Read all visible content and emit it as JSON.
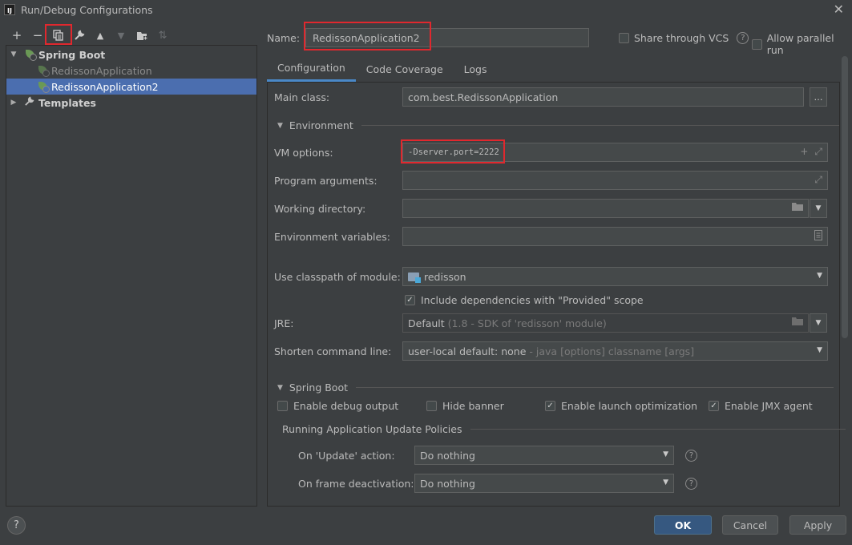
{
  "window": {
    "title": "Run/Debug Configurations",
    "app_icon_text": "IJ"
  },
  "toolbar": {
    "buttons": [
      {
        "name": "add",
        "glyph": "+"
      },
      {
        "name": "remove",
        "glyph": "−"
      },
      {
        "name": "copy",
        "glyph": "⧉"
      },
      {
        "name": "edit-defaults",
        "glyph": "🔧"
      },
      {
        "name": "move-up",
        "glyph": "▲"
      },
      {
        "name": "move-down",
        "glyph": "▼"
      },
      {
        "name": "new-folder",
        "glyph": "📁"
      },
      {
        "name": "sort",
        "glyph": "⇅"
      }
    ]
  },
  "tree": {
    "spring_boot": "Spring Boot",
    "items": [
      "RedissonApplication",
      "RedissonApplication2"
    ],
    "templates": "Templates"
  },
  "header": {
    "name_label": "Name:",
    "name_value": "RedissonApplication2",
    "share_label": "Share through VCS",
    "parallel_label": "Allow parallel run"
  },
  "tabs": [
    "Configuration",
    "Code Coverage",
    "Logs"
  ],
  "config": {
    "main_class_label": "Main class:",
    "main_class_value": "com.best.RedissonApplication",
    "environment_header": "Environment",
    "vm_options_label": "VM options:",
    "vm_options_value": "-Dserver.port=2222",
    "program_args_label": "Program arguments:",
    "working_dir_label": "Working directory:",
    "env_vars_label": "Environment variables:",
    "classpath_label": "Use classpath of module:",
    "classpath_value": "redisson",
    "include_deps_label": "Include dependencies with \"Provided\" scope",
    "jre_label": "JRE:",
    "jre_value": "Default",
    "jre_hint": "(1.8 - SDK of 'redisson' module)",
    "shorten_label": "Shorten command line:",
    "shorten_value": "user-local default: none",
    "shorten_hint": "- java [options] classname [args]",
    "spring_boot_header": "Spring Boot",
    "enable_debug_label": "Enable debug output",
    "hide_banner_label": "Hide banner",
    "launch_opt_label": "Enable launch optimization",
    "jmx_label": "Enable JMX agent",
    "policies_header": "Running Application Update Policies",
    "on_update_label": "On 'Update' action:",
    "on_update_value": "Do nothing",
    "on_frame_label": "On frame deactivation:",
    "on_frame_value": "Do nothing"
  },
  "footer": {
    "help": "?",
    "ok": "OK",
    "cancel": "Cancel",
    "apply": "Apply"
  },
  "colors": {
    "accent": "#4a88c7",
    "selection": "#4b6eaf",
    "highlight_box": "#e0282e",
    "primary_button": "#365880"
  }
}
